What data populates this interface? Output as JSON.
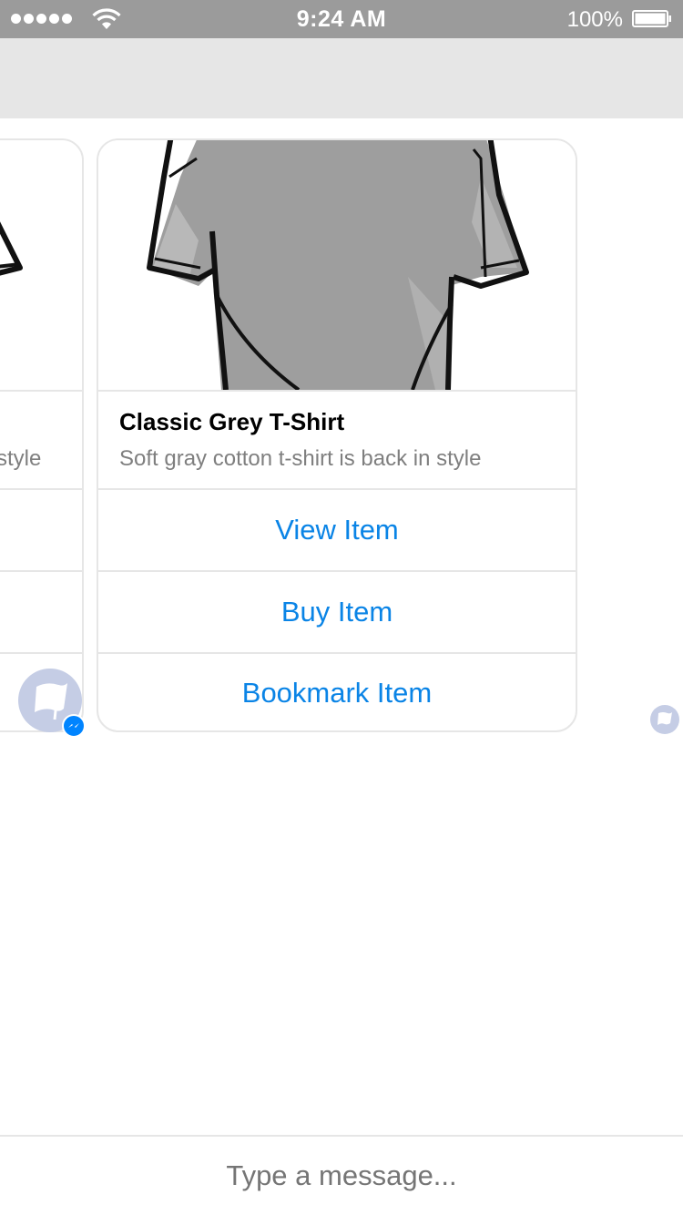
{
  "status_bar": {
    "time": "9:24 AM",
    "battery_percent": "100%",
    "signal_bars": 5,
    "icons": [
      "signal-dots-icon",
      "wifi-icon",
      "battery-icon"
    ]
  },
  "carousel": {
    "previous_card": {
      "subtitle_visible": "style"
    },
    "current_card": {
      "title": "Classic Grey T-Shirt",
      "subtitle": "Soft gray cotton t-shirt is back in style",
      "buttons": [
        {
          "label": "View Item"
        },
        {
          "label": "Buy Item"
        },
        {
          "label": "Bookmark Item"
        }
      ]
    }
  },
  "composer": {
    "placeholder": "Type a message..."
  },
  "colors": {
    "status_bar": "#9b9b9b",
    "header": "#e6e6e6",
    "button_text": "#0a84e6",
    "avatar": "#c5cde5",
    "messenger_badge": "#0084ff"
  }
}
